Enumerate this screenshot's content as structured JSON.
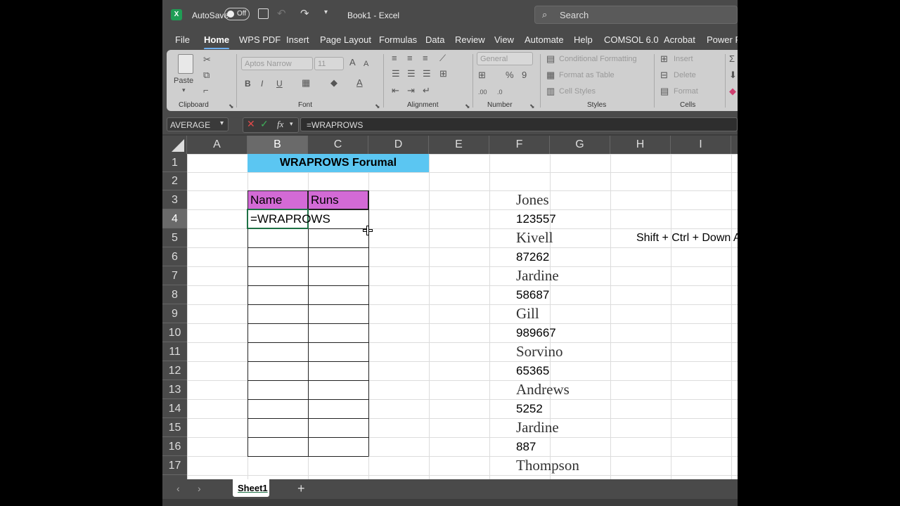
{
  "titlebar": {
    "autosave_label": "AutoSave",
    "toggle_label": "Off",
    "doc_title": "Book1  -  Excel",
    "search_placeholder": "Search"
  },
  "tabs": [
    "File",
    "Home",
    "WPS PDF",
    "Insert",
    "Page Layout",
    "Formulas",
    "Data",
    "Review",
    "View",
    "Automate",
    "Help",
    "COMSOL 6.0",
    "Acrobat",
    "Power P"
  ],
  "active_tab": "Home",
  "ribbon": {
    "clipboard": {
      "label": "Clipboard",
      "paste": "Paste"
    },
    "font": {
      "label": "Font",
      "name": "Aptos Narrow",
      "size": "11",
      "bold": "B",
      "italic": "I",
      "underline": "U"
    },
    "alignment": {
      "label": "Alignment"
    },
    "number": {
      "label": "Number",
      "format": "General",
      "percent": "%",
      "comma": "9"
    },
    "styles": {
      "label": "Styles",
      "conditional": "Conditional Formatting",
      "table": "Format as Table",
      "cell_styles": "Cell Styles"
    },
    "cells": {
      "label": "Cells",
      "insert": "Insert",
      "delete": "Delete",
      "format": "Format"
    }
  },
  "formula_bar": {
    "name_box": "AVERAGE",
    "fx": "fx",
    "formula": "=WRAPROWS"
  },
  "columns": [
    "A",
    "B",
    "C",
    "D",
    "E",
    "F",
    "G",
    "H",
    "I"
  ],
  "rows": [
    "1",
    "2",
    "3",
    "4",
    "5",
    "6",
    "7",
    "8",
    "9",
    "10",
    "11",
    "12",
    "13",
    "14",
    "15",
    "16",
    "17"
  ],
  "selected_col": "B",
  "selected_row": "4",
  "sheet": {
    "title_cell": "WRAPROWS Forumal",
    "header_name": "Name",
    "header_runs": "Runs",
    "active_cell": "=WRAPROWS",
    "note": "Shift + Ctrl + Down Arr",
    "f_column": [
      "Jones",
      "123557",
      "Kivell",
      "87262",
      "Jardine",
      "58687",
      "Gill",
      "989667",
      "Sorvino",
      "65365",
      "Andrews",
      "5252",
      "Jardine",
      "887",
      "Thompson"
    ]
  },
  "sheet_tabs": {
    "active": "Sheet1",
    "add": "+"
  },
  "colors": {
    "title_fill": "#5bc6f2",
    "header_fill": "#d36ad6",
    "chrome": "#4a4a4a",
    "ribbon": "#cfcfcf",
    "active_border": "#1e7145"
  }
}
